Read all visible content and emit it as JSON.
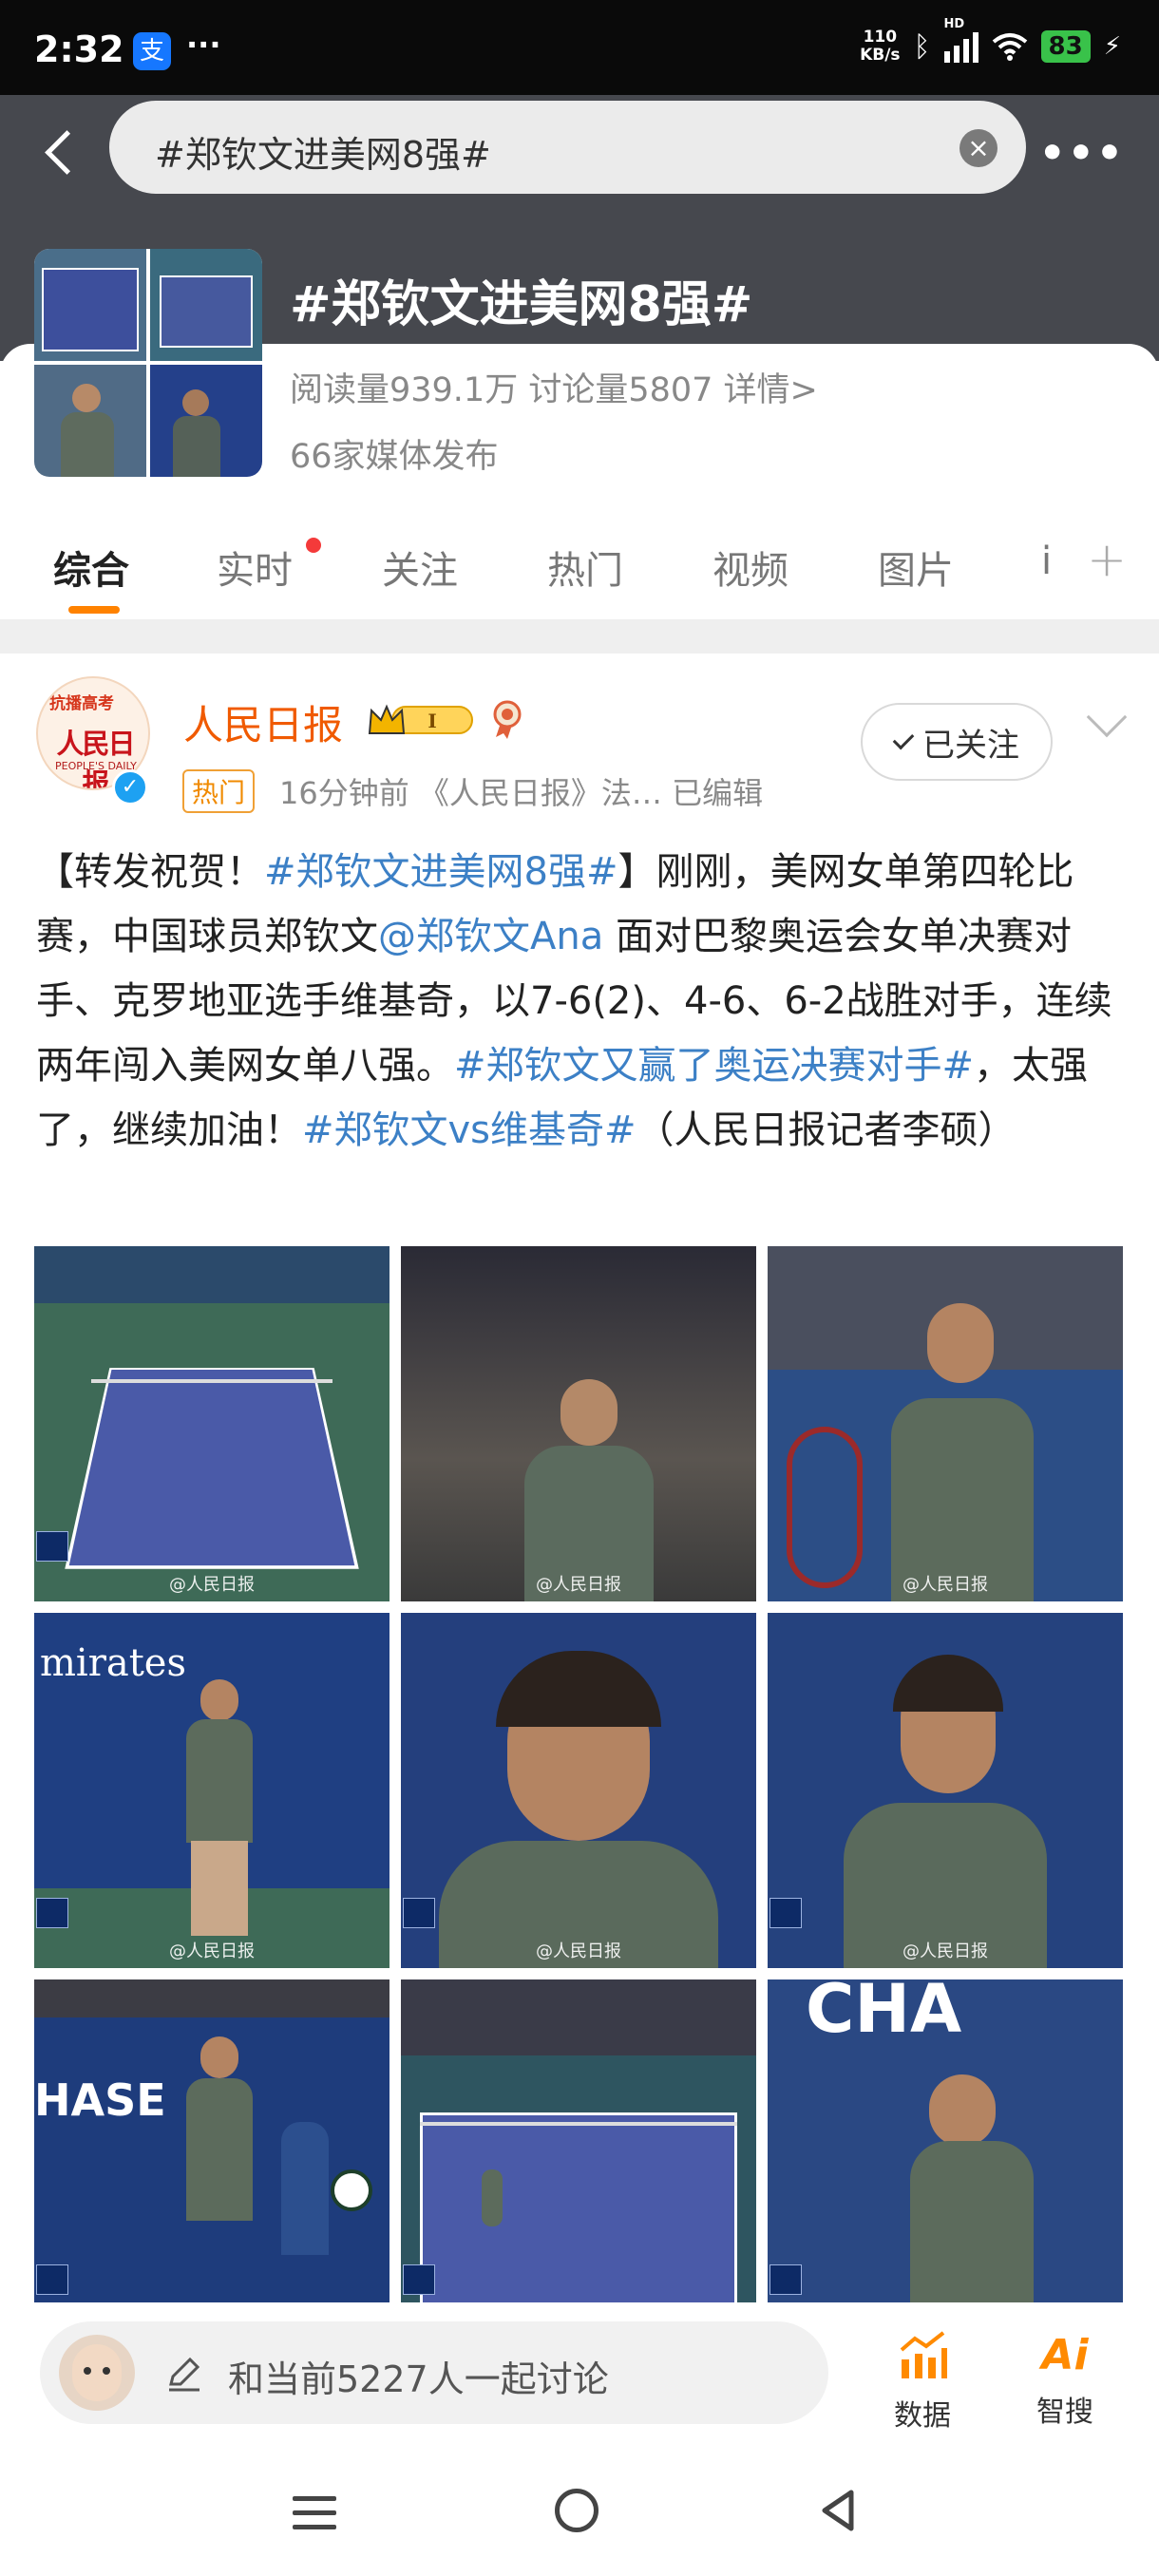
{
  "status_bar": {
    "time": "2:32",
    "alipay_glyph": "支",
    "dots": "···",
    "net_speed_value": "110",
    "net_speed_unit": "KB/s",
    "bluetooth_icon": "bluetooth-icon",
    "hd": "HD",
    "battery": "83"
  },
  "search": {
    "query": "#郑钦文进美网8强#"
  },
  "topic": {
    "title": "#郑钦文进美网8强#",
    "stats": "阅读量939.1万  讨论量5807  详情>",
    "media": "66家媒体发布"
  },
  "tabs": [
    {
      "label": "综合"
    },
    {
      "label": "实时"
    },
    {
      "label": "关注"
    },
    {
      "label": "热门"
    },
    {
      "label": "视频"
    },
    {
      "label": "图片"
    },
    {
      "label": "i"
    }
  ],
  "post": {
    "author": "人民日报",
    "avatar_cap": "抗播高考",
    "avatar_logo": "人民日报",
    "avatar_sub": "PEOPLE'S DAILY",
    "hot_tag": "热门",
    "meta": "16分钟前  《人民日报》法…  已编辑",
    "follow_label": "已关注",
    "text_parts": {
      "p1": "【转发祝贺！",
      "h1": "#郑钦文进美网8强#",
      "p2": "】刚刚，美网女单第四轮比赛，中国球员郑钦文",
      "m1": "@郑钦文Ana",
      "p3": " 面对巴黎奥运会女单决赛对手、克罗地亚选手维基奇，以7-6(2)、4-6、6-2战胜对手，连续两年闯入美网女单八强。",
      "h2": "#郑钦文又赢了奥运决赛对手#",
      "p4": "，太强了，继续加油！",
      "h3": "#郑钦文vs维基奇#",
      "p5": "（人民日报记者李硕）"
    },
    "watermark": "@人民日报",
    "photos": [
      {
        "kind": "court"
      },
      {
        "kind": "player"
      },
      {
        "kind": "player"
      },
      {
        "kind": "player"
      },
      {
        "kind": "closeup"
      },
      {
        "kind": "closeup"
      },
      {
        "kind": "player"
      },
      {
        "kind": "court"
      },
      {
        "kind": "player"
      }
    ]
  },
  "bottom_bar": {
    "input_placeholder": "和当前5227人一起讨论",
    "data_label": "数据",
    "ai_label": "智搜",
    "ai_glyph": "Ai"
  },
  "colors": {
    "accent": "#ff8200",
    "link": "#3c80c6",
    "author": "#f05a00"
  }
}
